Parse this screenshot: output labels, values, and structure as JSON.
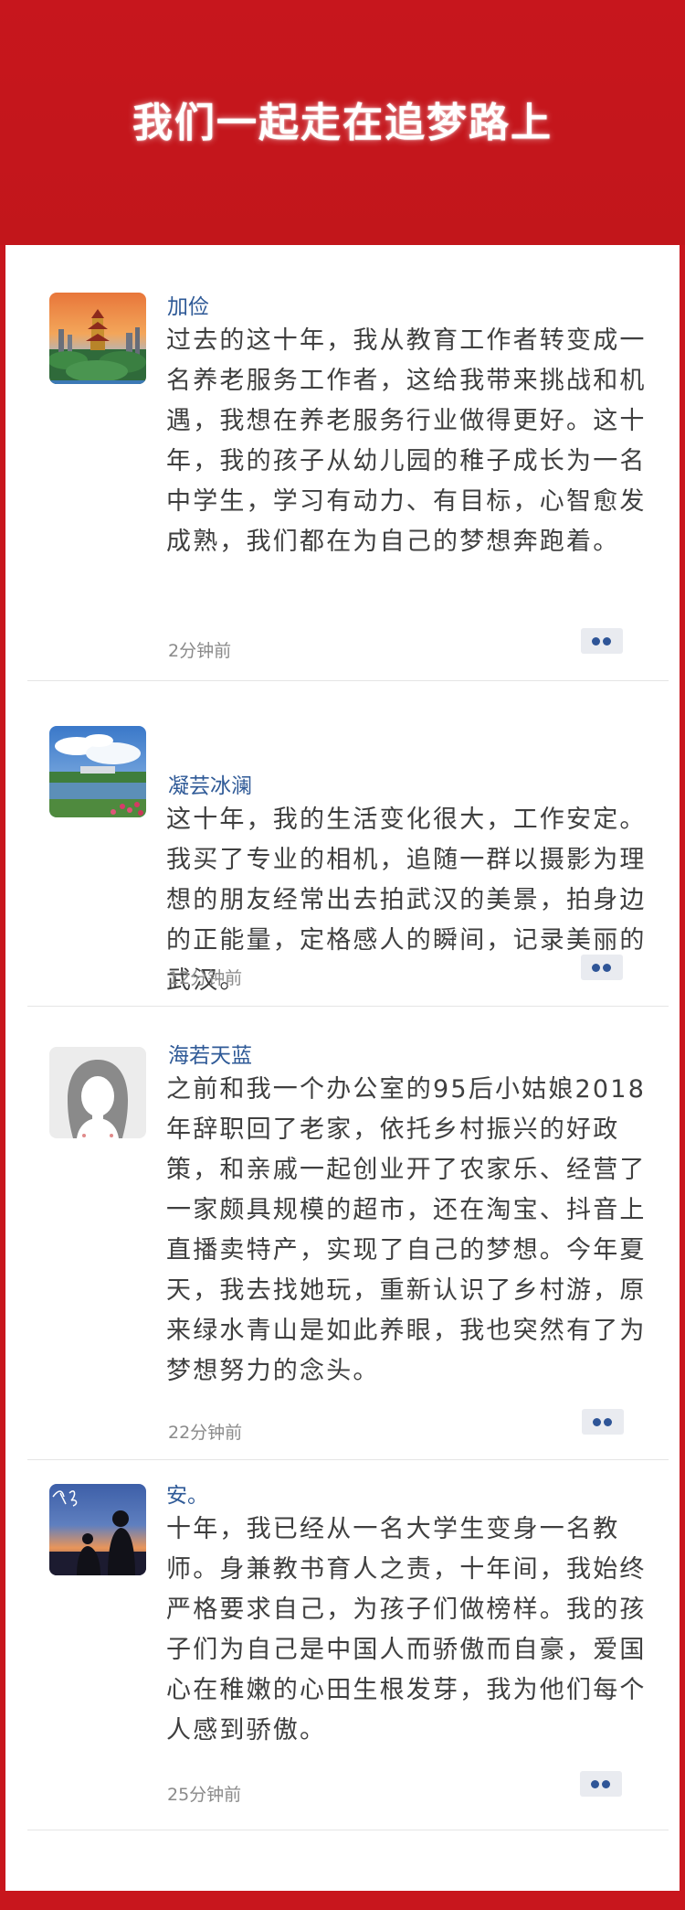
{
  "header": {
    "title": "我们一起走在追梦路上"
  },
  "comments": [
    {
      "username": "加俭",
      "avatar_icon": "yellow-crane-tower-photo-avatar",
      "text": "过去的这十年，我从教育工作者转变成一名养老服务工作者，这给我带来挑战和机遇，我想在养老服务行业做得更好。这十年，我的孩子从幼儿园的稚子成长为一名中学生，学习有动力、有目标，心智愈发成熟，我们都在为自己的梦想奔跑着。",
      "time": "2分钟前"
    },
    {
      "username": "凝芸冰澜",
      "avatar_icon": "lake-landscape-photo-avatar",
      "text": "这十年，我的生活变化很大，工作安定。我买了专业的相机，追随一群以摄影为理想的朋友经常出去拍武汉的美景，拍身边的正能量，定格感人的瞬间，记录美丽的武汉。",
      "time": "12分钟前"
    },
    {
      "username": "海若天蓝",
      "avatar_icon": "default-female-silhouette-avatar",
      "text": "之前和我一个办公室的95后小姑娘2018年辞职回了老家，依托乡村振兴的好政策，和亲戚一起创业开了农家乐、经营了一家颇具规模的超市，还在淘宝、抖音上直播卖特产，实现了自己的梦想。今年夏天，我去找她玩，重新认识了乡村游，原来绿水青山是如此养眼，我也突然有了为梦想努力的念头。",
      "time": "22分钟前"
    },
    {
      "username": "安。",
      "avatar_icon": "sunset-silhouette-photo-avatar",
      "text": "十年，我已经从一名大学生变身一名教师。身兼教书育人之责，十年间，我始终严格要求自己，为孩子们做榜样。我的孩子们为自己是中国人而骄傲而自豪，爱国心在稚嫩的心田生根发芽，我为他们每个人感到骄傲。",
      "time": "25分钟前"
    }
  ]
}
